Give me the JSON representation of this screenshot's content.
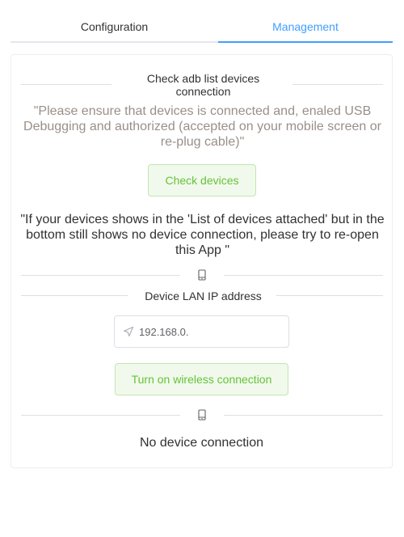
{
  "tabs": {
    "configuration": "Configuration",
    "management": "Management"
  },
  "check_section": {
    "title": "Check adb list devices connection",
    "hint": "\"Please ensure that devices is connected and, enaled USB Debugging and authorized (accepted on your mobile screen or re-plug cable)\"",
    "button_label": "Check devices",
    "note": "\"If your devices shows in the 'List of devices attached' but in the bottom still shows no device connection, please try to re-open this App \""
  },
  "lan_section": {
    "label": "Device LAN IP address",
    "ip_value": "192.168.0.",
    "button_label": "Turn on wireless connection"
  },
  "status": {
    "text": "No device connection"
  },
  "colors": {
    "accent": "#409eff",
    "success": "#67c23a",
    "success_bg": "#f0f9eb",
    "success_border": "#c2e7b0",
    "hint_text": "#9a8f89"
  },
  "icons": {
    "device": "tablet-icon",
    "location": "navigation-arrow-icon"
  }
}
